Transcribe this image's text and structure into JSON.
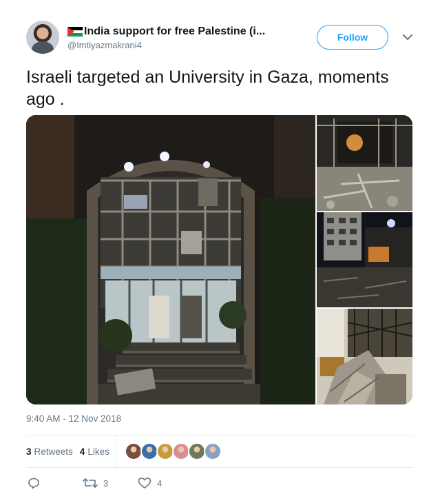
{
  "author": {
    "display_name": "India support for free Palestine (i...",
    "handle": "@Imtiyazmakrani4"
  },
  "follow_label": "Follow",
  "tweet_text": "Israeli targeted an University in Gaza, moments ago .",
  "timestamp": "9:40 AM - 12 Nov 2018",
  "stats": {
    "retweets_count": "3",
    "retweets_label": "Retweets",
    "likes_count": "4",
    "likes_label": "Likes"
  },
  "liker_colors": [
    "#7a4e3a",
    "#3b6fa8",
    "#c99a3c",
    "#d98f8f",
    "#6d7a5a",
    "#8aa0c0"
  ],
  "actions": {
    "reply_count": "",
    "retweet_count": "3",
    "like_count": "4"
  },
  "icons": {
    "reply": "reply-icon",
    "retweet": "retweet-icon",
    "like": "heart-icon",
    "caret": "chevron-down-icon",
    "flag": "palestine-flag-icon"
  },
  "colors": {
    "accent": "#1da1f2",
    "muted": "#657786",
    "text": "#14171a"
  }
}
